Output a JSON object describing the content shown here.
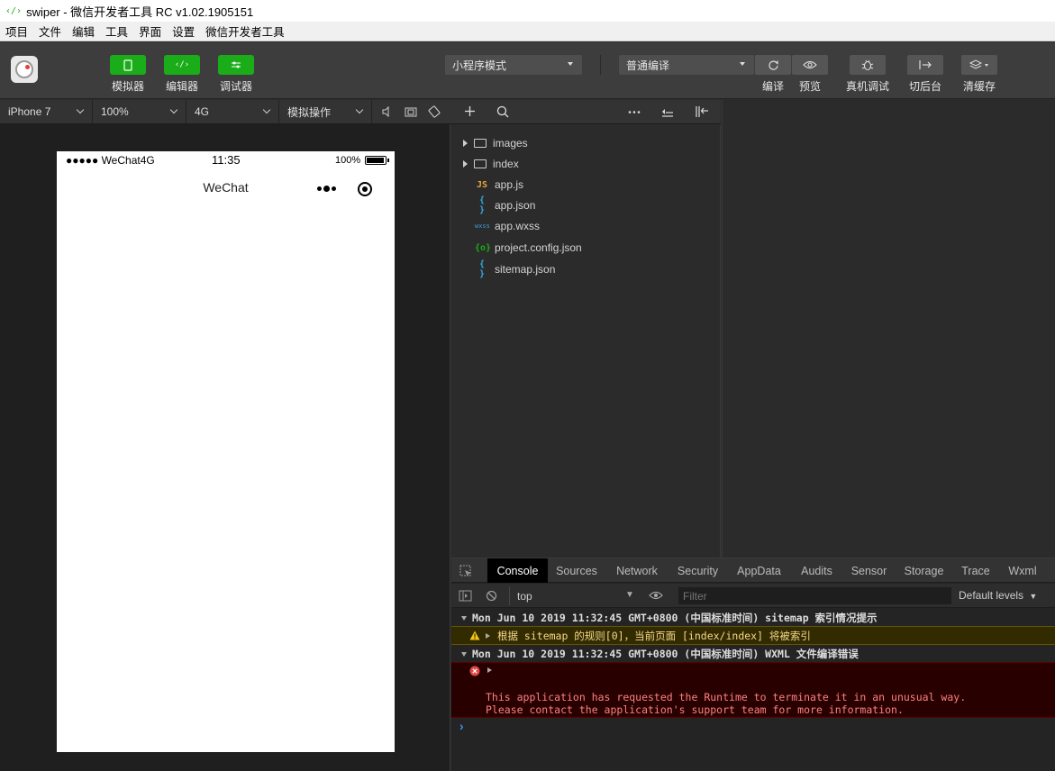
{
  "window": {
    "title": "swiper - 微信开发者工具 RC v1.02.1905151"
  },
  "menu": [
    "项目",
    "文件",
    "编辑",
    "工具",
    "界面",
    "设置",
    "微信开发者工具"
  ],
  "toolbar": {
    "simulator": "模拟器",
    "editor": "编辑器",
    "debugger": "调试器",
    "mode": "小程序模式",
    "compile_mode": "普通编译",
    "compile": "编译",
    "preview": "预览",
    "remote_debug": "真机调试",
    "background": "切后台",
    "clear_cache": "清缓存"
  },
  "simbar": {
    "device": "iPhone 7",
    "zoom": "100%",
    "network": "4G",
    "sim_ops": "模拟操作"
  },
  "phone": {
    "carrier": "●●●●● WeChat4G",
    "time": "11:35",
    "battery": "100%",
    "nav_title": "WeChat"
  },
  "files": [
    {
      "name": "images",
      "type": "folder"
    },
    {
      "name": "index",
      "type": "folder"
    },
    {
      "name": "app.js",
      "type": "js",
      "icon": "JS",
      "color": "#e8a33c"
    },
    {
      "name": "app.json",
      "type": "json",
      "icon": "{ }",
      "color": "#35a6e0"
    },
    {
      "name": "app.wxss",
      "type": "wxss",
      "icon": "wxss",
      "color": "#3ea0d8"
    },
    {
      "name": "project.config.json",
      "type": "config",
      "icon": "{o}",
      "color": "#1aad19"
    },
    {
      "name": "sitemap.json",
      "type": "json",
      "icon": "{ }",
      "color": "#35a6e0"
    }
  ],
  "devtools": {
    "tabs": [
      "Console",
      "Sources",
      "Network",
      "Security",
      "AppData",
      "Audits",
      "Sensor",
      "Storage",
      "Trace",
      "Wxml"
    ],
    "active_tab": "Console",
    "context": "top",
    "filter_placeholder": "Filter",
    "levels": "Default levels",
    "logs": {
      "group1": "Mon Jun 10 2019 11:32:45 GMT+0800 (中国标准时间) sitemap 索引情况提示",
      "warning": "根据 sitemap 的规则[0]，当前页面 [index/index] 将被索引",
      "group2": "Mon Jun 10 2019 11:32:45 GMT+0800 (中国标准时间)  WXML 文件编译错误",
      "error_line1": "This application has requested the Runtime to terminate it in an unusual way.",
      "error_line2": "Please contact the application's support team for more information."
    },
    "prompt": "›"
  },
  "colors": {
    "accent_green": "#1aad19",
    "error_red": "#e04848",
    "warning_yellow": "#f5c518"
  }
}
